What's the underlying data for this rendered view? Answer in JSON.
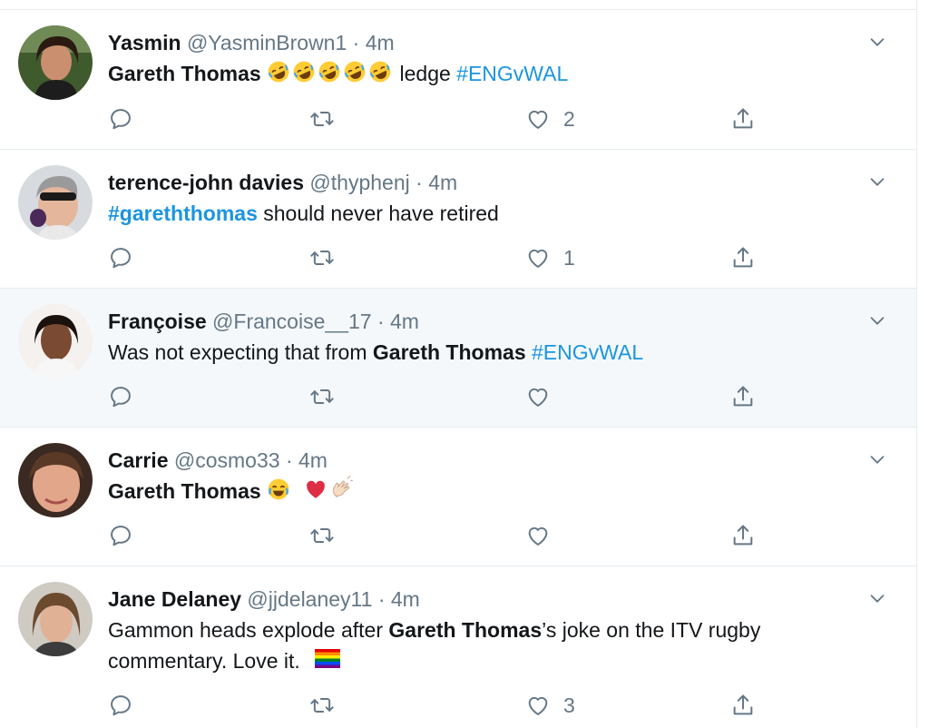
{
  "tweets": [
    {
      "name": "Yasmin",
      "handle": "@YasminBrown1",
      "time": "4m",
      "text_pre": "",
      "bold": "Gareth Thomas",
      "text_mid": "ledge",
      "hashtag": "#ENGvWAL",
      "text_post": "",
      "emoji": [
        "rofl",
        "rofl",
        "rofl",
        "rofl",
        "rofl"
      ],
      "likes": "2",
      "avatar": "avatar-yasmin",
      "highlighted": false
    },
    {
      "name": "terence-john davies",
      "handle": "@thyphenj",
      "time": "4m",
      "hashtag_bold": "#gareththomas",
      "text": "should never have retired",
      "likes": "1",
      "avatar": "avatar-terence",
      "highlighted": false
    },
    {
      "name": "Françoise",
      "handle": "@Francoise__17",
      "time": "4m",
      "text_pre": "Was not expecting that from",
      "bold": "Gareth Thomas",
      "hashtag": "#ENGvWAL",
      "likes": "",
      "avatar": "avatar-francoise",
      "highlighted": true
    },
    {
      "name": "Carrie",
      "handle": "@cosmo33",
      "time": "4m",
      "bold": "Gareth Thomas",
      "emoji": [
        "joy",
        "red-heart",
        "clap"
      ],
      "likes": "",
      "avatar": "avatar-carrie",
      "highlighted": false
    },
    {
      "name": "Jane Delaney",
      "handle": "@jjdelaney11",
      "time": "4m",
      "text_pre": "Gammon heads explode after",
      "bold": "Gareth Thomas",
      "text_post": "’s joke on the ITV rugby",
      "text_line2": "commentary. Love it.",
      "emoji": [
        "rainbow-flag"
      ],
      "likes": "3",
      "avatar": "avatar-jane",
      "highlighted": false
    }
  ],
  "icons": {
    "reply": "reply-icon",
    "retweet": "retweet-icon",
    "like": "heart-icon",
    "share": "share-icon",
    "menu": "chevron-down-icon"
  },
  "colors": {
    "hashtag": "#1b95e0",
    "meta": "#657786",
    "text": "#14171a",
    "highlight": "#f5f8fa"
  }
}
